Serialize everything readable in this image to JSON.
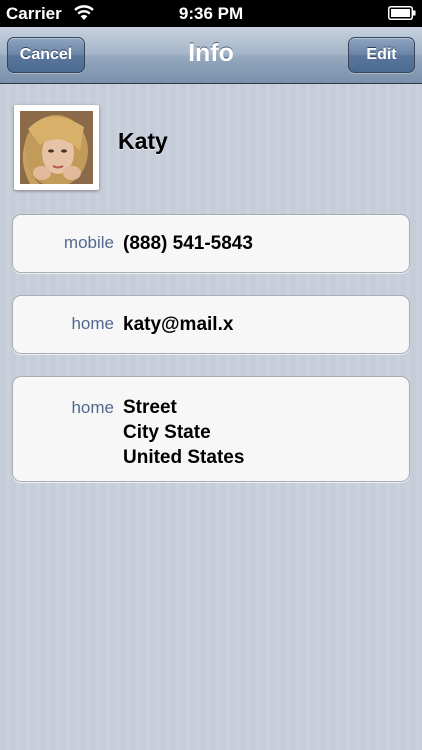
{
  "status_bar": {
    "carrier": "Carrier",
    "time": "9:36 PM",
    "wifi_icon": "wifi-icon",
    "battery_icon": "battery-icon"
  },
  "nav_bar": {
    "title": "Info",
    "left_button": "Cancel",
    "right_button": "Edit"
  },
  "contact": {
    "name": "Katy",
    "photo_icon": "contact-photo",
    "fields": [
      {
        "label": "mobile",
        "value": "(888) 541-5843"
      },
      {
        "label": "home",
        "value": "katy@mail.x"
      },
      {
        "label": "home",
        "lines": [
          "Street",
          "City State",
          "United States"
        ]
      }
    ]
  },
  "colors": {
    "status_bar_bg": "#000000",
    "nav_bar_accent": "#7a90ab",
    "field_label": "#52698f",
    "background": "#c7cdd8"
  }
}
